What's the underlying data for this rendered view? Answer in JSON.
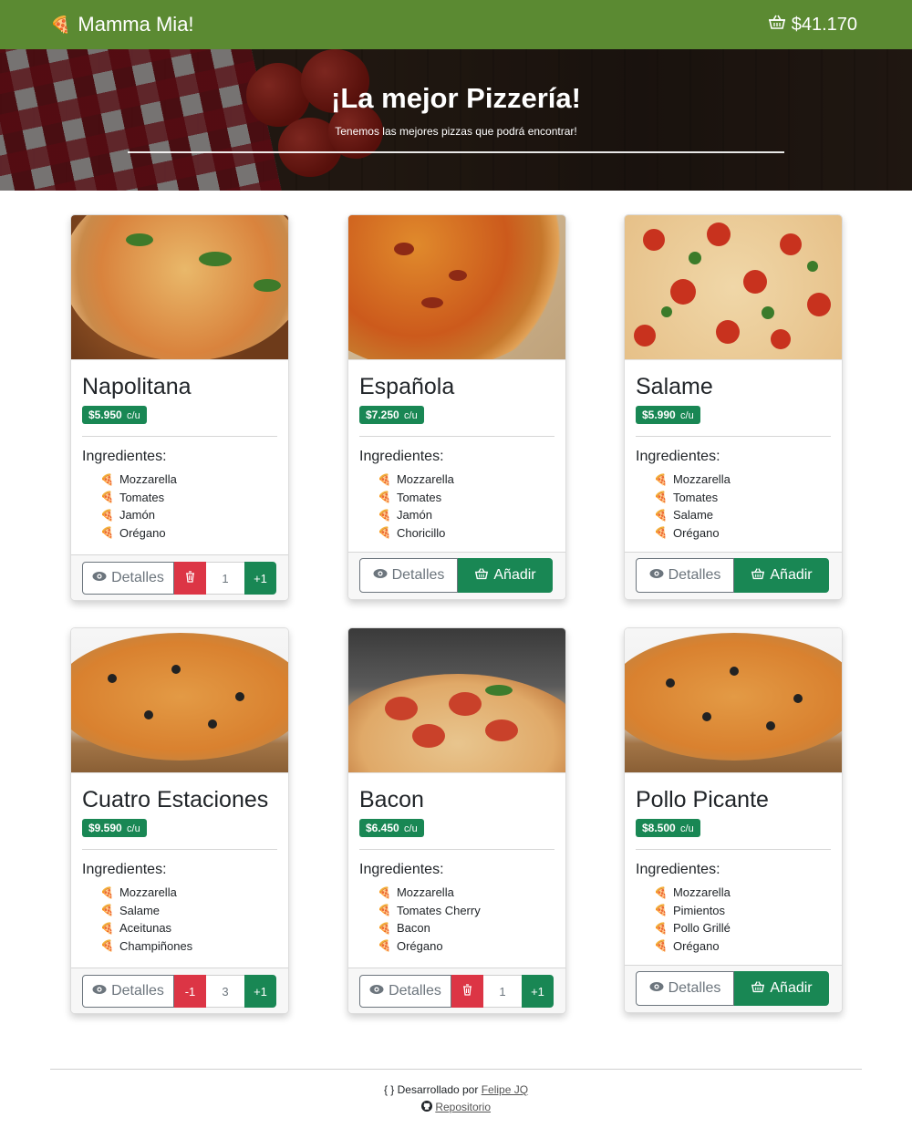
{
  "navbar": {
    "brand": "Mamma Mia!",
    "brand_icon": "pizza-icon",
    "cart_icon": "basket-icon",
    "cart_total": "$41.170",
    "bg_color": "#5b8a32"
  },
  "hero": {
    "title": "¡La mejor Pizzería!",
    "subtitle": "Tenemos las mejores pizzas que podrá encontrar!"
  },
  "labels": {
    "ingredients": "Ingredientes:",
    "details": "Detalles",
    "add": "Añadir",
    "per_unit": "c/u",
    "minus": "-1",
    "plus": "+1"
  },
  "colors": {
    "success": "#198754",
    "danger": "#dc3545",
    "secondary": "#6c757d"
  },
  "pizzas": [
    {
      "name": "Napolitana",
      "price": "$5.950",
      "ingredients": [
        "Mozzarella",
        "Tomates",
        "Jamón",
        "Orégano"
      ],
      "in_cart": true,
      "qty": "1",
      "left_action": "trash-icon"
    },
    {
      "name": "Española",
      "price": "$7.250",
      "ingredients": [
        "Mozzarella",
        "Tomates",
        "Jamón",
        "Choricillo"
      ],
      "in_cart": false
    },
    {
      "name": "Salame",
      "price": "$5.990",
      "ingredients": [
        "Mozzarella",
        "Tomates",
        "Salame",
        "Orégano"
      ],
      "in_cart": false
    },
    {
      "name": "Cuatro Estaciones",
      "price": "$9.590",
      "ingredients": [
        "Mozzarella",
        "Salame",
        "Aceitunas",
        "Champiñones"
      ],
      "in_cart": true,
      "qty": "3",
      "left_action": "minus"
    },
    {
      "name": "Bacon",
      "price": "$6.450",
      "ingredients": [
        "Mozzarella",
        "Tomates Cherry",
        "Bacon",
        "Orégano"
      ],
      "in_cart": true,
      "qty": "1",
      "left_action": "trash-icon"
    },
    {
      "name": "Pollo Picante",
      "price": "$8.500",
      "ingredients": [
        "Mozzarella",
        "Pimientos",
        "Pollo Grillé",
        "Orégano"
      ],
      "in_cart": false
    }
  ],
  "footer": {
    "credit_icon": "braces-icon",
    "credit_text": "Desarrollado por",
    "author": "Felipe JQ",
    "repo_icon": "github-icon",
    "repo": "Repositorio"
  }
}
